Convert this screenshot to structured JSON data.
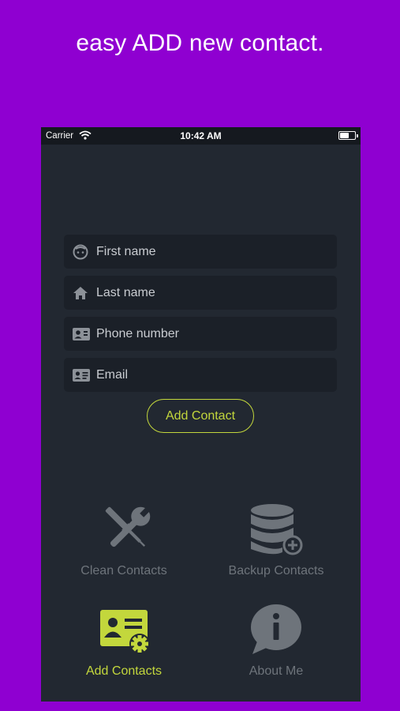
{
  "headline": "easy ADD new contact.",
  "status_bar": {
    "carrier": "Carrier",
    "time": "10:42 AM"
  },
  "form": {
    "fields": [
      {
        "name": "first-name",
        "placeholder": "First name",
        "icon": "face-icon"
      },
      {
        "name": "last-name",
        "placeholder": "Last name",
        "icon": "home-icon"
      },
      {
        "name": "phone-number",
        "placeholder": "Phone number",
        "icon": "contact-card-icon"
      },
      {
        "name": "email",
        "placeholder": "Email",
        "icon": "id-card-icon"
      }
    ],
    "submit_label": "Add Contact"
  },
  "menu": {
    "items": [
      {
        "label": "Clean Contacts",
        "icon": "tools-icon",
        "active": false
      },
      {
        "label": "Backup Contacts",
        "icon": "database-add-icon",
        "active": false
      },
      {
        "label": "Add Contacts",
        "icon": "contact-settings-icon",
        "active": true
      },
      {
        "label": "About Me",
        "icon": "info-bubble-icon",
        "active": false
      }
    ]
  },
  "colors": {
    "background": "#8f00d1",
    "panel": "#222831",
    "field": "#1b2028",
    "accent": "#c3d73c",
    "muted_icon": "#6e747b"
  }
}
